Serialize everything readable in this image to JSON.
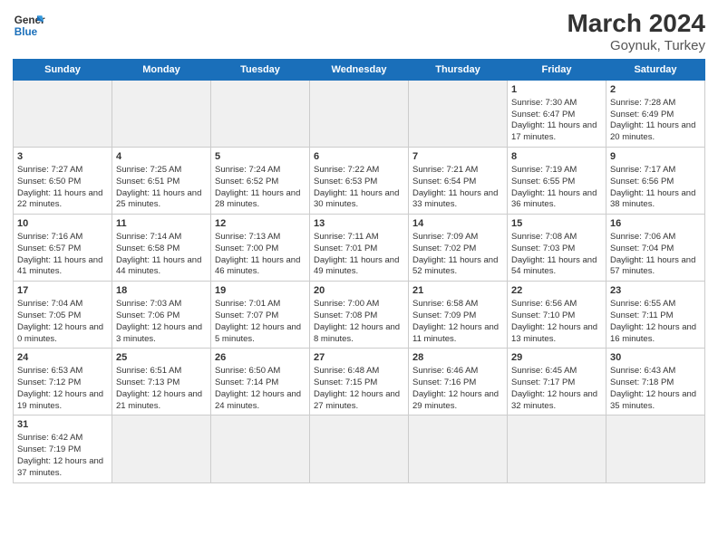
{
  "header": {
    "logo_general": "General",
    "logo_blue": "Blue",
    "month_year": "March 2024",
    "location": "Goynuk, Turkey"
  },
  "days_of_week": [
    "Sunday",
    "Monday",
    "Tuesday",
    "Wednesday",
    "Thursday",
    "Friday",
    "Saturday"
  ],
  "rows": [
    [
      {
        "day": "",
        "empty": true
      },
      {
        "day": "",
        "empty": true
      },
      {
        "day": "",
        "empty": true
      },
      {
        "day": "",
        "empty": true
      },
      {
        "day": "",
        "empty": true
      },
      {
        "day": "1",
        "sunrise": "7:30 AM",
        "sunset": "6:47 PM",
        "daylight": "11 hours and 17 minutes."
      },
      {
        "day": "2",
        "sunrise": "7:28 AM",
        "sunset": "6:49 PM",
        "daylight": "11 hours and 20 minutes."
      }
    ],
    [
      {
        "day": "3",
        "sunrise": "7:27 AM",
        "sunset": "6:50 PM",
        "daylight": "11 hours and 22 minutes."
      },
      {
        "day": "4",
        "sunrise": "7:25 AM",
        "sunset": "6:51 PM",
        "daylight": "11 hours and 25 minutes."
      },
      {
        "day": "5",
        "sunrise": "7:24 AM",
        "sunset": "6:52 PM",
        "daylight": "11 hours and 28 minutes."
      },
      {
        "day": "6",
        "sunrise": "7:22 AM",
        "sunset": "6:53 PM",
        "daylight": "11 hours and 30 minutes."
      },
      {
        "day": "7",
        "sunrise": "7:21 AM",
        "sunset": "6:54 PM",
        "daylight": "11 hours and 33 minutes."
      },
      {
        "day": "8",
        "sunrise": "7:19 AM",
        "sunset": "6:55 PM",
        "daylight": "11 hours and 36 minutes."
      },
      {
        "day": "9",
        "sunrise": "7:17 AM",
        "sunset": "6:56 PM",
        "daylight": "11 hours and 38 minutes."
      }
    ],
    [
      {
        "day": "10",
        "sunrise": "7:16 AM",
        "sunset": "6:57 PM",
        "daylight": "11 hours and 41 minutes."
      },
      {
        "day": "11",
        "sunrise": "7:14 AM",
        "sunset": "6:58 PM",
        "daylight": "11 hours and 44 minutes."
      },
      {
        "day": "12",
        "sunrise": "7:13 AM",
        "sunset": "7:00 PM",
        "daylight": "11 hours and 46 minutes."
      },
      {
        "day": "13",
        "sunrise": "7:11 AM",
        "sunset": "7:01 PM",
        "daylight": "11 hours and 49 minutes."
      },
      {
        "day": "14",
        "sunrise": "7:09 AM",
        "sunset": "7:02 PM",
        "daylight": "11 hours and 52 minutes."
      },
      {
        "day": "15",
        "sunrise": "7:08 AM",
        "sunset": "7:03 PM",
        "daylight": "11 hours and 54 minutes."
      },
      {
        "day": "16",
        "sunrise": "7:06 AM",
        "sunset": "7:04 PM",
        "daylight": "11 hours and 57 minutes."
      }
    ],
    [
      {
        "day": "17",
        "sunrise": "7:04 AM",
        "sunset": "7:05 PM",
        "daylight": "12 hours and 0 minutes."
      },
      {
        "day": "18",
        "sunrise": "7:03 AM",
        "sunset": "7:06 PM",
        "daylight": "12 hours and 3 minutes."
      },
      {
        "day": "19",
        "sunrise": "7:01 AM",
        "sunset": "7:07 PM",
        "daylight": "12 hours and 5 minutes."
      },
      {
        "day": "20",
        "sunrise": "7:00 AM",
        "sunset": "7:08 PM",
        "daylight": "12 hours and 8 minutes."
      },
      {
        "day": "21",
        "sunrise": "6:58 AM",
        "sunset": "7:09 PM",
        "daylight": "12 hours and 11 minutes."
      },
      {
        "day": "22",
        "sunrise": "6:56 AM",
        "sunset": "7:10 PM",
        "daylight": "12 hours and 13 minutes."
      },
      {
        "day": "23",
        "sunrise": "6:55 AM",
        "sunset": "7:11 PM",
        "daylight": "12 hours and 16 minutes."
      }
    ],
    [
      {
        "day": "24",
        "sunrise": "6:53 AM",
        "sunset": "7:12 PM",
        "daylight": "12 hours and 19 minutes."
      },
      {
        "day": "25",
        "sunrise": "6:51 AM",
        "sunset": "7:13 PM",
        "daylight": "12 hours and 21 minutes."
      },
      {
        "day": "26",
        "sunrise": "6:50 AM",
        "sunset": "7:14 PM",
        "daylight": "12 hours and 24 minutes."
      },
      {
        "day": "27",
        "sunrise": "6:48 AM",
        "sunset": "7:15 PM",
        "daylight": "12 hours and 27 minutes."
      },
      {
        "day": "28",
        "sunrise": "6:46 AM",
        "sunset": "7:16 PM",
        "daylight": "12 hours and 29 minutes."
      },
      {
        "day": "29",
        "sunrise": "6:45 AM",
        "sunset": "7:17 PM",
        "daylight": "12 hours and 32 minutes."
      },
      {
        "day": "30",
        "sunrise": "6:43 AM",
        "sunset": "7:18 PM",
        "daylight": "12 hours and 35 minutes."
      }
    ],
    [
      {
        "day": "31",
        "sunrise": "6:42 AM",
        "sunset": "7:19 PM",
        "daylight": "12 hours and 37 minutes."
      },
      {
        "day": "",
        "empty": true
      },
      {
        "day": "",
        "empty": true
      },
      {
        "day": "",
        "empty": true
      },
      {
        "day": "",
        "empty": true
      },
      {
        "day": "",
        "empty": true
      },
      {
        "day": "",
        "empty": true
      }
    ]
  ]
}
